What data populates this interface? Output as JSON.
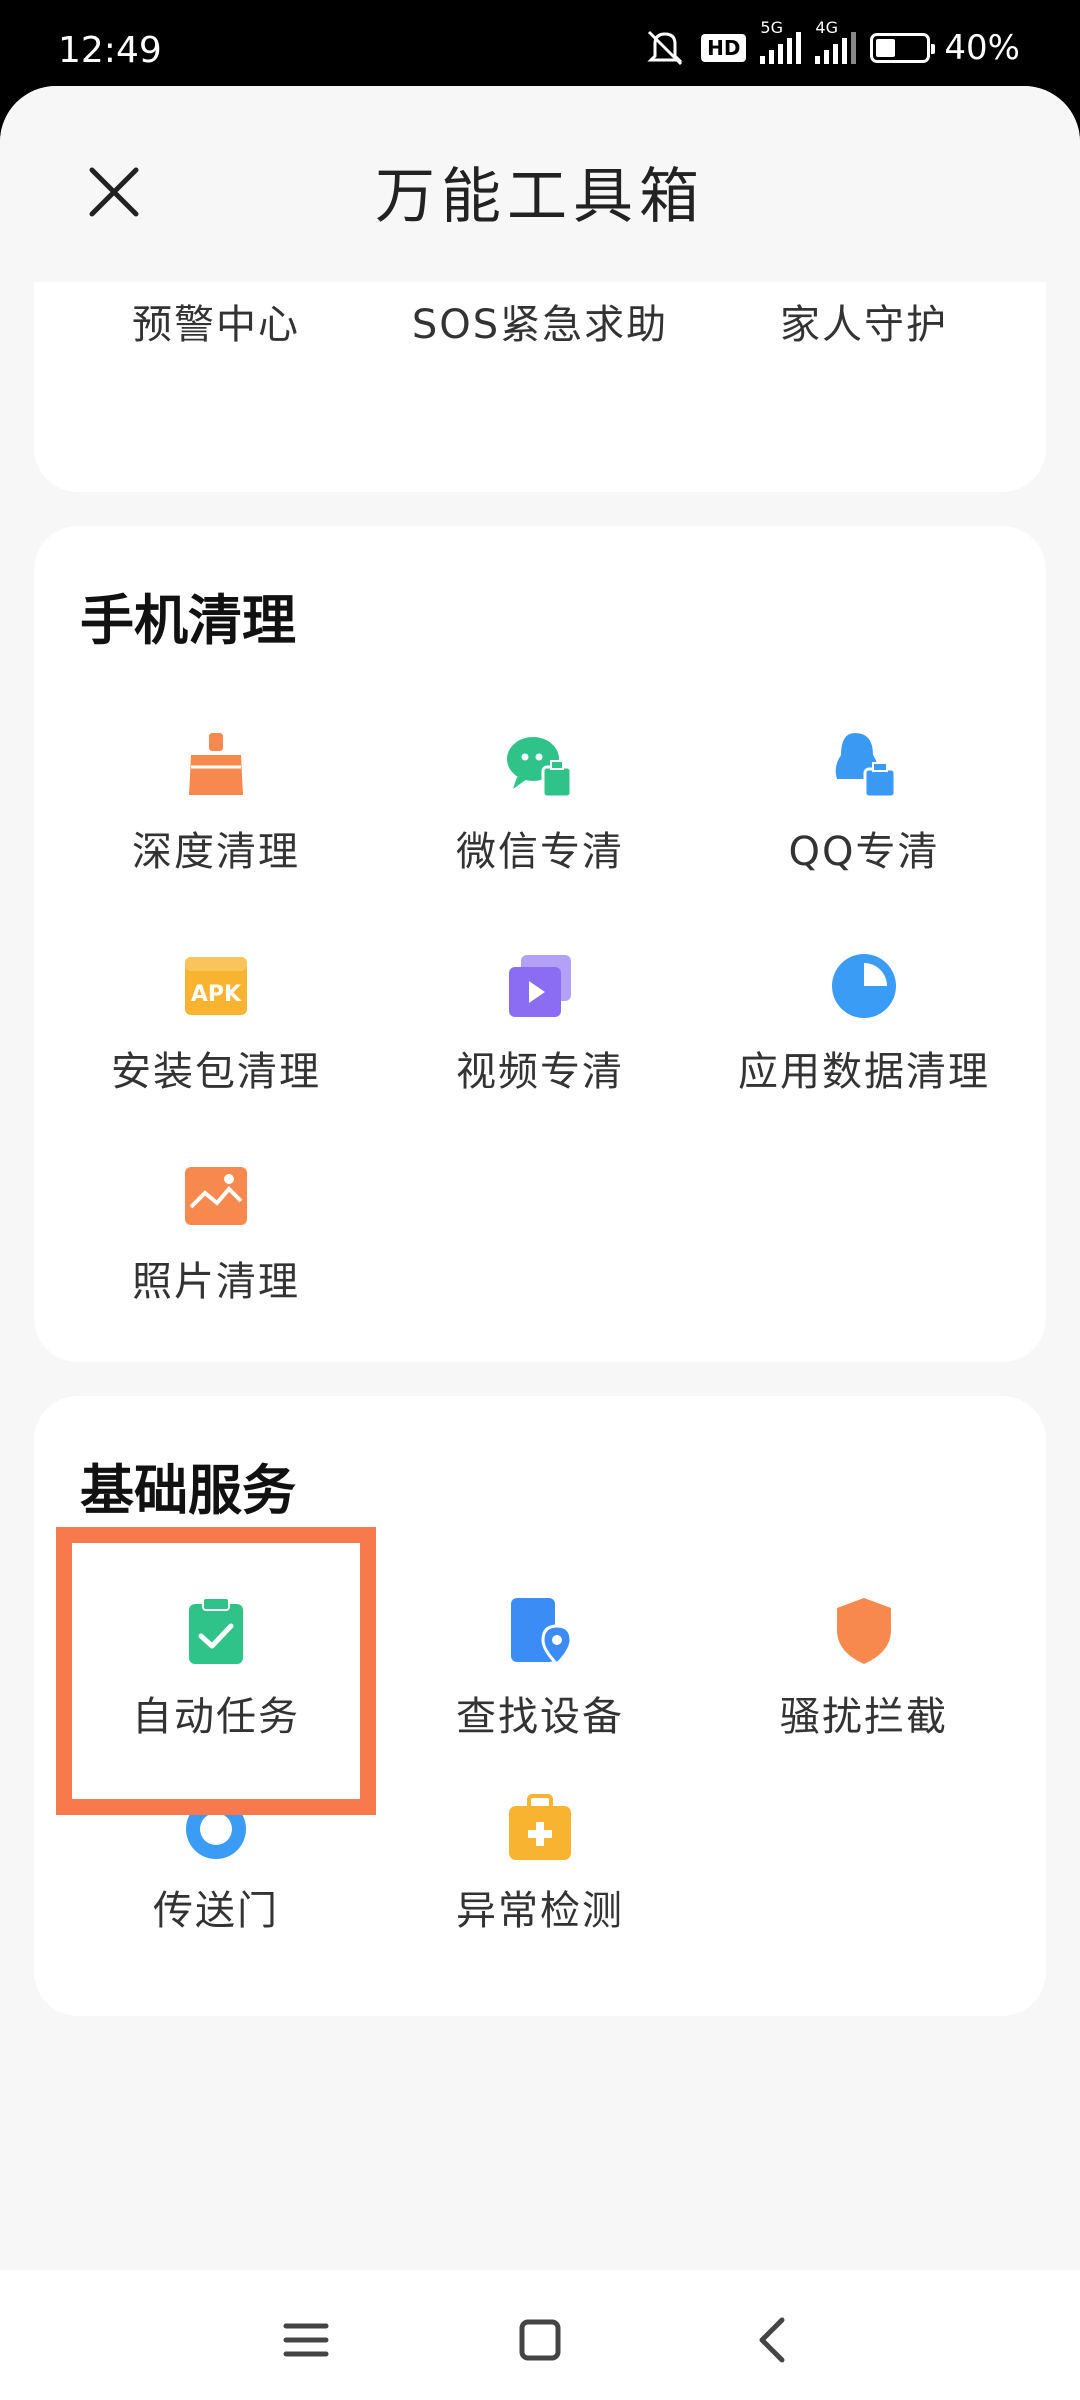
{
  "status_bar": {
    "time": "12:49",
    "hd": "HD",
    "signal_1": "5G",
    "signal_2": "4G",
    "battery_text": "40%",
    "battery_level": 0.4
  },
  "header": {
    "title": "万能工具箱",
    "close_icon": "close-icon"
  },
  "top_section": {
    "items": [
      {
        "label": "预警中心",
        "icon": "alarm-icon",
        "color": "#f56362"
      },
      {
        "label": "SOS紧急求助",
        "icon": "sos-icon",
        "color": "#f7814c"
      },
      {
        "label": "家人守护",
        "icon": "family-guard-icon",
        "color": "#4ab1f4"
      }
    ]
  },
  "phone_cleanup": {
    "title": "手机清理",
    "items": [
      {
        "label": "深度清理",
        "icon": "broom-icon",
        "color": "#f7894f"
      },
      {
        "label": "微信专清",
        "icon": "wechat-clean-icon",
        "color": "#2fc38a"
      },
      {
        "label": "QQ专清",
        "icon": "qq-clean-icon",
        "color": "#3a9af3"
      },
      {
        "label": "安装包清理",
        "icon": "apk-icon",
        "color": "#f8b431"
      },
      {
        "label": "视频专清",
        "icon": "video-icon",
        "color": "#8a6df2"
      },
      {
        "label": "应用数据清理",
        "icon": "pie-chart-icon",
        "color": "#3b9cf6"
      },
      {
        "label": "照片清理",
        "icon": "photo-icon",
        "color": "#f7894f"
      }
    ]
  },
  "basic_services": {
    "title": "基础服务",
    "items": [
      {
        "label": "自动任务",
        "icon": "auto-task-icon",
        "color": "#2fc38a"
      },
      {
        "label": "查找设备",
        "icon": "find-device-icon",
        "color": "#3b8cf5"
      },
      {
        "label": "骚扰拦截",
        "icon": "shield-icon",
        "color": "#f7894f"
      },
      {
        "label": "传送门",
        "icon": "portal-icon",
        "color": "#3b9cf6"
      },
      {
        "label": "异常检测",
        "icon": "medical-kit-icon",
        "color": "#f8b431"
      }
    ]
  },
  "nav_bar": {
    "menu_icon": "menu-icon",
    "home_icon": "home-icon",
    "back_icon": "back-icon"
  }
}
